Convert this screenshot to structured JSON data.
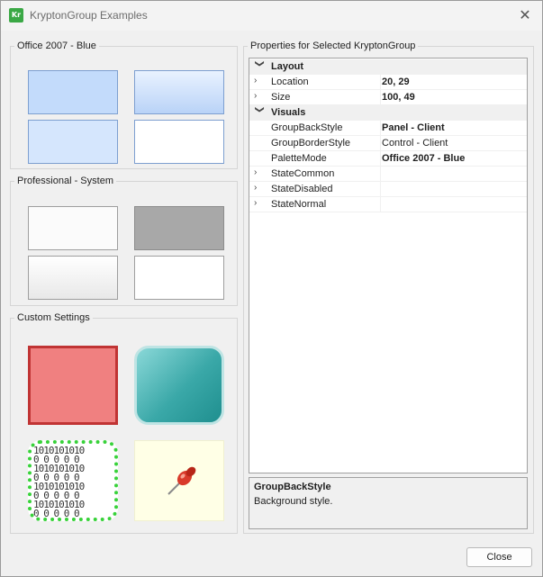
{
  "window": {
    "title": "KryptonGroup Examples",
    "icon_text": "Kr",
    "close_icon": "close-icon"
  },
  "groups": {
    "office": {
      "label": "Office 2007 - Blue"
    },
    "professional": {
      "label": "Professional - System"
    },
    "custom": {
      "label": "Custom Settings"
    }
  },
  "custom_samples": {
    "binary_text": "1010101010\n0 0 0 0 0\n1010101010\n0 0 0 0 0\n1010101010\n0 0 0 0 0\n1010101010\n0 0 0 0 0",
    "pin_icon": "pushpin-icon"
  },
  "properties_panel": {
    "label": "Properties for Selected KryptonGroup",
    "rows": [
      {
        "kind": "category",
        "expander": "❯",
        "name": "Layout",
        "value": ""
      },
      {
        "kind": "prop",
        "expander": "›",
        "name": "Location",
        "value": "20, 29",
        "bold": true
      },
      {
        "kind": "prop",
        "expander": "›",
        "name": "Size",
        "value": "100, 49",
        "bold": true
      },
      {
        "kind": "category",
        "expander": "❯",
        "name": "Visuals",
        "value": ""
      },
      {
        "kind": "prop",
        "expander": "",
        "name": "GroupBackStyle",
        "value": "Panel - Client",
        "bold": true
      },
      {
        "kind": "prop",
        "expander": "",
        "name": "GroupBorderStyle",
        "value": "Control - Client",
        "bold": false
      },
      {
        "kind": "prop",
        "expander": "",
        "name": "PaletteMode",
        "value": "Office 2007 - Blue",
        "bold": true
      },
      {
        "kind": "prop",
        "expander": "›",
        "name": "StateCommon",
        "value": "",
        "bold": false
      },
      {
        "kind": "prop",
        "expander": "›",
        "name": "StateDisabled",
        "value": "",
        "bold": false
      },
      {
        "kind": "prop",
        "expander": "›",
        "name": "StateNormal",
        "value": "",
        "bold": false
      }
    ],
    "description": {
      "title": "GroupBackStyle",
      "text": "Background style."
    }
  },
  "buttons": {
    "close_label": "Close"
  }
}
